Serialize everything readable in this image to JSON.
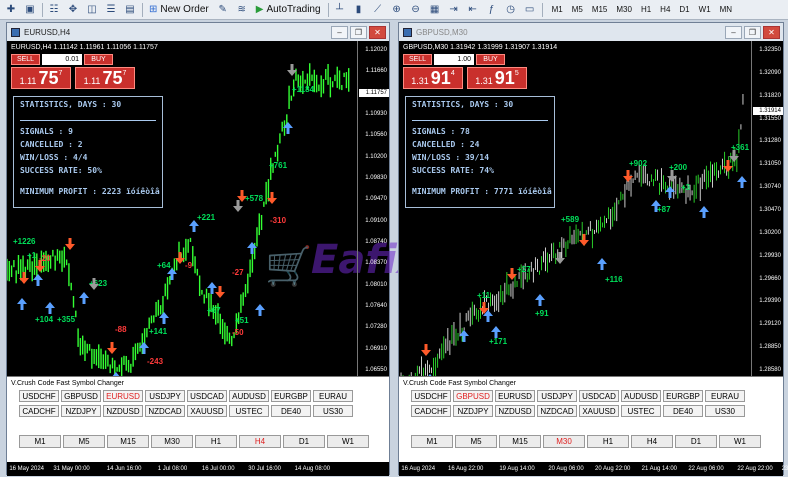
{
  "toolbar": {
    "new_order": "New Order",
    "autotrading": "AutoTrading",
    "timeframes": [
      "M1",
      "M5",
      "M15",
      "M30",
      "H1",
      "H4",
      "D1",
      "W1",
      "MN"
    ]
  },
  "windows": [
    {
      "title": "EURUSD,H4",
      "symbol_info": "EURUSD,H4  1.11142 1.11961 1.11056 1.11757",
      "sell_label": "SELL",
      "buy_label": "BUY",
      "lot": "0.01",
      "sell_price": {
        "big": "1.11",
        "main": "75",
        "sup": "7"
      },
      "buy_price": {
        "big": "1.11",
        "main": "75",
        "sup": "7"
      },
      "current_price": "1.11757",
      "prices": [
        "1.12020",
        "1.11660",
        "1.11290",
        "1.10930",
        "1.10560",
        "1.10200",
        "1.09830",
        "1.09470",
        "1.09100",
        "1.08740",
        "1.08370",
        "1.08010",
        "1.07640",
        "1.07280",
        "1.06910",
        "1.06550"
      ],
      "stats": {
        "title": "STATISTICS, DAYS : 30",
        "signals": "SIGNALS : 9",
        "cancelled": "CANCELLED : 2",
        "winloss": "WIN/LOSS : 4/4",
        "success": "SUCCESS RATE: 50%",
        "profit": "MINIMUM PROFIT : 2223 ïóíêòîâ"
      },
      "labels_green": [
        "+1184",
        "+761",
        "+578",
        "+221",
        "+64",
        "+623",
        "+1226",
        "+104",
        "+355",
        "+141",
        "+67",
        "+51",
        "+1"
      ],
      "labels_red": [
        "-310",
        "-27",
        "-9",
        "-20",
        "-243",
        "-88",
        "-50",
        "-59"
      ],
      "panel_title": "V.Crush Code Fast Symbol Changer",
      "symbols_row1": [
        "USDCHF",
        "GBPUSD",
        "EURUSD",
        "USDJPY",
        "USDCAD",
        "AUDUSD",
        "EURGBP",
        "EURAU"
      ],
      "symbols_row2": [
        "CADCHF",
        "NZDJPY",
        "NZDUSD",
        "NZDCAD",
        "XAUUSD",
        "USTEC",
        "DE40",
        "US30"
      ],
      "active_symbol": "EURUSD",
      "timeframes": [
        "M1",
        "M5",
        "M15",
        "M30",
        "H1",
        "H4",
        "D1",
        "W1"
      ],
      "active_tf": "H4",
      "dates": [
        "16 May 2024",
        "31 May 00:00",
        "14 Jun 16:00",
        "1 Jul 08:00",
        "16 Jul 00:00",
        "30 Jul 16:00",
        "14 Aug 08:00"
      ]
    },
    {
      "title": "GBPUSD,M30",
      "symbol_info": "GBPUSD,M30  1.31942 1.31999 1.31907 1.31914",
      "sell_label": "SELL",
      "buy_label": "BUY",
      "lot": "1.00",
      "sell_price": {
        "big": "1.31",
        "main": "91",
        "sup": "4"
      },
      "buy_price": {
        "big": "1.31",
        "main": "91",
        "sup": "5"
      },
      "current_price": "1.31914",
      "prices": [
        "1.32350",
        "1.32090",
        "1.31820",
        "1.31550",
        "1.31280",
        "1.31050",
        "1.30740",
        "1.30470",
        "1.30200",
        "1.29930",
        "1.29660",
        "1.29390",
        "1.29120",
        "1.28850",
        "1.28580"
      ],
      "stats": {
        "title": "STATISTICS, DAYS : 30",
        "signals": "SIGNALS : 78",
        "cancelled": "CANCELLED : 24",
        "winloss": "WIN/LOSS : 39/14",
        "success": "SUCCESS RATE: 74%",
        "profit": "MINIMUM PROFIT : 7771 ïóíêòîâ"
      },
      "labels_green": [
        "+361",
        "+902",
        "+200",
        "+87",
        "+3",
        "+589",
        "+116",
        "+27",
        "+91",
        "+171",
        "+11"
      ],
      "labels_red": [
        "-51"
      ],
      "panel_title": "V.Crush Code Fast Symbol Changer",
      "symbols_row1": [
        "USDCHF",
        "GBPUSD",
        "EURUSD",
        "USDJPY",
        "USDCAD",
        "AUDUSD",
        "EURGBP",
        "EURAU"
      ],
      "symbols_row2": [
        "CADCHF",
        "NZDJPY",
        "NZDUSD",
        "NZDCAD",
        "XAUUSD",
        "USTEC",
        "DE40",
        "US30"
      ],
      "active_symbol": "GBPUSD",
      "timeframes": [
        "M1",
        "M5",
        "M15",
        "M30",
        "H1",
        "H4",
        "D1",
        "W1"
      ],
      "active_tf": "M30",
      "dates": [
        "16 Aug 2024",
        "16 Aug 22:00",
        "19 Aug 14:00",
        "20 Aug 06:00",
        "20 Aug 22:00",
        "21 Aug 14:00",
        "22 Aug 06:00",
        "22 Aug 22:00",
        "23 Aug 14:00"
      ]
    }
  ],
  "watermark": "Eafix",
  "colors": {
    "green": "#00e05a",
    "red": "#ff3a3a",
    "blue": "#5aa0ff",
    "grey": "#9a9a9a",
    "stats": "#a9c9ee"
  }
}
